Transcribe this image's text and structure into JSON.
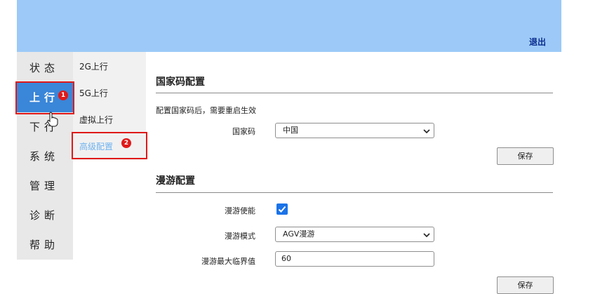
{
  "header": {
    "logout_label": "退出"
  },
  "left_nav": [
    {
      "label": "状态"
    },
    {
      "label": "上行"
    },
    {
      "label": "下行"
    },
    {
      "label": "系统"
    },
    {
      "label": "管理"
    },
    {
      "label": "诊断"
    },
    {
      "label": "帮助"
    }
  ],
  "active_left_nav": "上行",
  "sub_nav": [
    {
      "label": "2G上行"
    },
    {
      "label": "5G上行"
    },
    {
      "label": "虚拟上行"
    },
    {
      "label": "高级配置"
    }
  ],
  "active_sub_nav": "高级配置",
  "annotations": {
    "badge1": "1",
    "badge2": "2"
  },
  "country_section": {
    "title": "国家码配置",
    "note": "配置国家码后，需要重启生效",
    "country_label": "国家码",
    "country_value": "中国",
    "save_label": "保存"
  },
  "roaming_section": {
    "title": "漫游配置",
    "enable_label": "漫游使能",
    "enable_checked": true,
    "mode_label": "漫游模式",
    "mode_value": "AGV漫游",
    "threshold_label": "漫游最大临界值",
    "threshold_value": "60",
    "save_label": "保存"
  },
  "colors": {
    "header_bg": "#9cc9f7",
    "active_nav_bg": "#3a86d8",
    "active_sub_text": "#6fb2ef",
    "annotation_red": "#e01919",
    "checkbox": "#1a73e8"
  }
}
